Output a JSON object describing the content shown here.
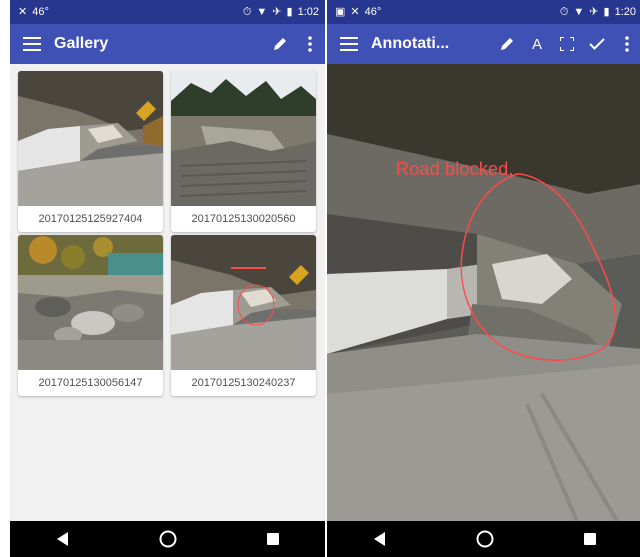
{
  "left_screen": {
    "status": {
      "left_icons": [
        "notification-icon",
        "weather-icon"
      ],
      "temp": "46°",
      "time": "1:02"
    },
    "appbar": {
      "title": "Gallery",
      "menu_icon": "menu-icon",
      "actions": [
        "pencil-icon",
        "more-vert-icon"
      ]
    },
    "gallery": {
      "items": [
        {
          "caption": "20170125125927404"
        },
        {
          "caption": "20170125130020560"
        },
        {
          "caption": "20170125130056147"
        },
        {
          "caption": "20170125130240237"
        }
      ]
    },
    "navbar": {
      "buttons": [
        "back-icon",
        "home-icon",
        "recents-icon"
      ]
    }
  },
  "right_screen": {
    "status": {
      "left_icons": [
        "image-icon",
        "notification-icon",
        "weather-icon"
      ],
      "temp": "46°",
      "time": "1:20"
    },
    "appbar": {
      "title": "Annotati...",
      "menu_icon": "menu-icon",
      "actions": [
        "pencil-icon",
        "text-icon",
        "fullscreen-icon",
        "check-icon",
        "more-vert-icon"
      ],
      "text_action_label": "A"
    },
    "photo": {
      "annotation_text": "Road blocked.",
      "annotation_color": "#ff4a4a"
    },
    "navbar": {
      "buttons": [
        "back-icon",
        "home-icon",
        "recents-icon"
      ]
    }
  },
  "colors": {
    "appbar": "#3f51b5",
    "statusbar": "#27368f",
    "navbar": "#000000"
  }
}
